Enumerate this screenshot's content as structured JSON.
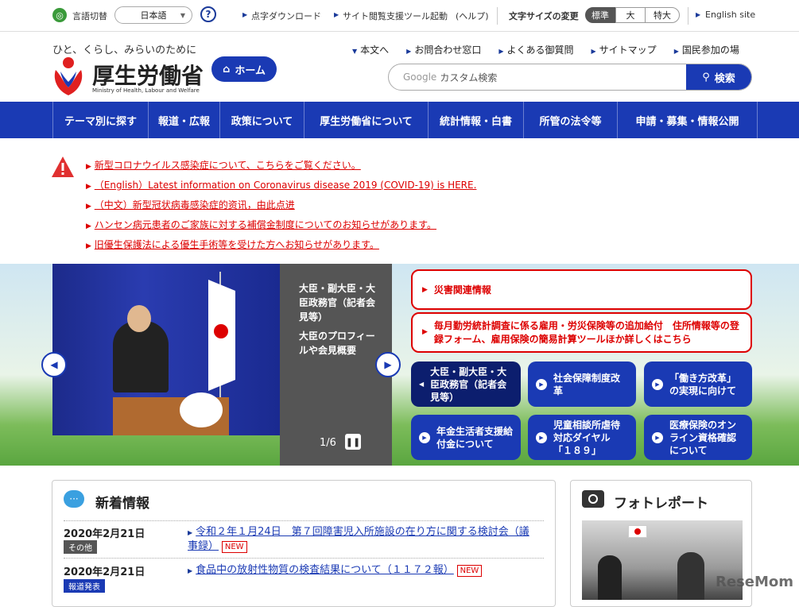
{
  "utility": {
    "lang_switch": "言語切替",
    "lang_value": "日本語",
    "help_icon": "?",
    "braille": "点字ダウンロード",
    "reader_tool": "サイト閲覧支援ツール起動",
    "reader_help": "(ヘルプ)",
    "font_size_label": "文字サイズの変更",
    "font_sizes": [
      "標準",
      "大",
      "特大"
    ],
    "english": "English site"
  },
  "header": {
    "tagline": "ひと、くらし、みらいのために",
    "ministry_name": "厚生労働省",
    "ministry_en": "Ministry of Health, Labour and Welfare",
    "home": "ホーム",
    "links": [
      "本文へ",
      "お問合わせ窓口",
      "よくある御質問",
      "サイトマップ",
      "国民参加の場"
    ],
    "search_brand": "Google",
    "search_placeholder": "カスタム検索",
    "search_button": "検索"
  },
  "nav": [
    "テーマ別に探す",
    "報道・広報",
    "政策について",
    "厚生労働省について",
    "統計情報・白書",
    "所管の法令等",
    "申請・募集・情報公開"
  ],
  "alerts": [
    "新型コロナウイルス感染症について、こちらをご覧ください。",
    "（English）Latest information on Coronavirus disease 2019 (COVID-19) is HERE.",
    "（中文）新型冠状病毒感染症的资讯，由此点进",
    "ハンセン病元患者のご家族に対する補償金制度についてのお知らせがあります。",
    "旧優生保護法による優生手術等を受けた方へお知らせがあります。"
  ],
  "hero": {
    "caption_title": "大臣・副大臣・大臣政務官（記者会見等）",
    "caption_sub": "大臣のプロフィールや会見概要",
    "counter": "1/6",
    "red_boxes": [
      "災害関連情報",
      "毎月勤労統計調査に係る雇用・労災保険等の追加給付　住所情報等の登録フォーム、雇用保険の簡易計算ツールほか詳しくはこちら"
    ],
    "blue_boxes": [
      "大臣・副大臣・大臣政務官（記者会見等）",
      "社会保障制度改革",
      "「働き方改革」の実現に向けて",
      "年金生活者支援給付金について",
      "児童相談所虐待対応ダイヤル「１８９」",
      "医療保険のオンライン資格確認について"
    ]
  },
  "news": {
    "title": "新着情報",
    "items": [
      {
        "date": "2020年2月21日",
        "tag": "その他",
        "title": "令和２年１月24日　第７回障害児入所施設の在り方に関する検討会（議事録）",
        "new": "NEW"
      },
      {
        "date": "2020年2月21日",
        "tag": "報道発表",
        "title": "食品中の放射性物質の検査結果について（１１７２報）",
        "new": "NEW"
      }
    ]
  },
  "photo": {
    "title": "フォトレポート"
  },
  "watermark": "ReseMom"
}
